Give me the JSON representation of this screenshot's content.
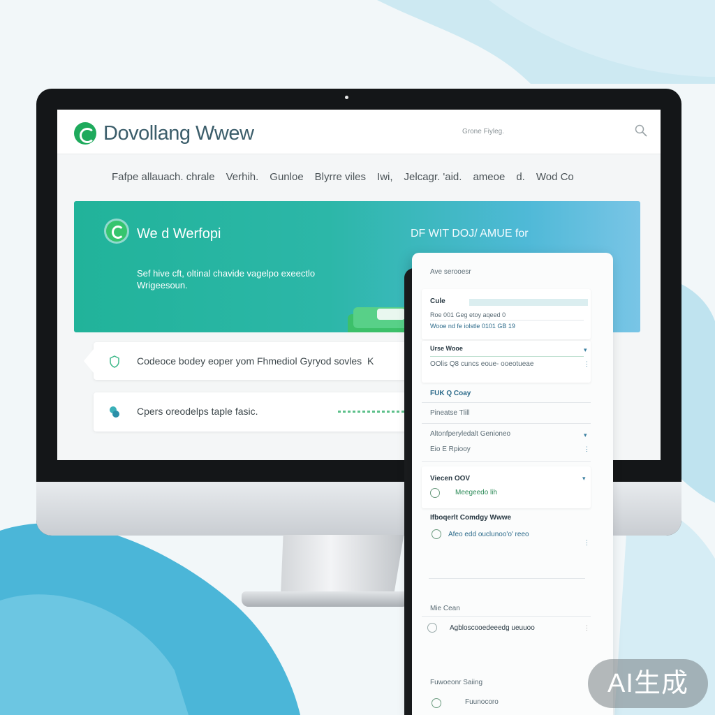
{
  "app": {
    "logo_text": "Dovollang Wwew",
    "top_link": "Grone Fiyleg."
  },
  "nav": {
    "items": [
      "Fafpe allauach. chrale",
      "Verhih.",
      "Gunloe",
      "Blyrre viles",
      "Iwi,",
      "Jelcagr. 'aid.",
      "ameoe",
      "d.",
      "Wod Co"
    ]
  },
  "hero": {
    "title": "We d Werfopi",
    "subtitle": "Sef hive cft, oltinal chavide vagelpo exeectlo Wrigeesoun.",
    "right_text": "DF WIT DOJ/ AMUE for"
  },
  "cta": [
    {
      "text": "Codeoce bodey eoper yom Fhmediol Gyryod sovles",
      "extra": "K"
    },
    {
      "text": "Cpers oreodelps taple fasic."
    }
  ],
  "phone": {
    "header": "Ave serooesr",
    "section1_title": "Cule",
    "section1_row1": "Roe 001 Geg etoy aqeed 0",
    "section1_row2": "Wooe nd fe iolstle 0101 GB 19",
    "section2_title": "Urse Wooe",
    "section2_row": "OOlis  Q8 cuncs  eoue-  ooeotueae",
    "section3_title": "FUK Q Coay",
    "section3_row": "Pineatse  Tlill",
    "section4_title": "Altonfperyledalt Genioneo",
    "section4_row": "Eio  E Rpiooy",
    "section5_title": "Viecen OOV",
    "section5_row": "Meegeedo lih",
    "section6_title": "Ifboqerlt Comdgy Wwwe",
    "section6_row": "Afeo edd  ouclunoo'o' reeo",
    "section7_title": "Mie Cean",
    "section7_row": "Agbloscooedeeedg ueuuoo",
    "section8_title": "Fuwoeonr Saiing",
    "section8_row": "Fuunocoro"
  },
  "watermark": "AI生成",
  "colors": {
    "brand_green": "#1eaa5c",
    "hero_teal": "#21b39a",
    "hero_blue": "#79c5e6",
    "text_dark": "#3b5d6a"
  },
  "icons": [
    "whatsapp-logo-icon",
    "search-icon",
    "chat-icon",
    "shield-icon",
    "green-circle-icon"
  ]
}
